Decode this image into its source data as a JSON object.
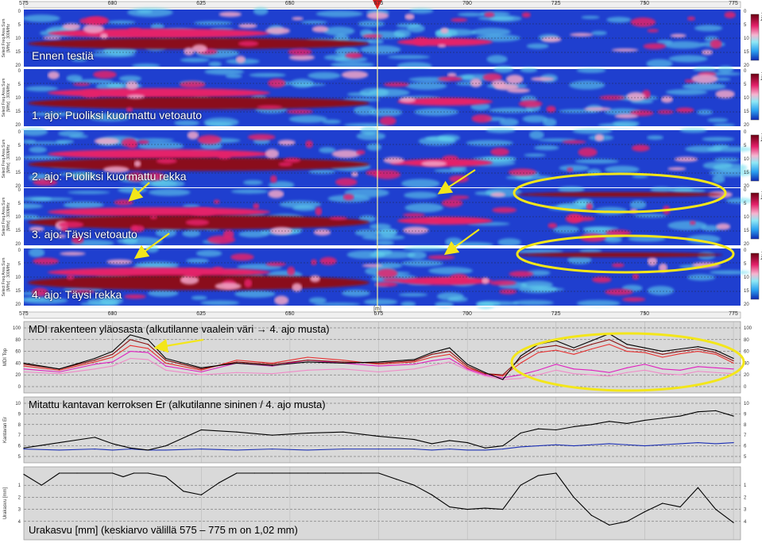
{
  "distance_axis": {
    "ticks": [
      "575",
      "600",
      "625",
      "650",
      "675",
      "700",
      "725",
      "750",
      "775"
    ],
    "unit": "[m]",
    "range": [
      575,
      777
    ],
    "marker_at": 674
  },
  "radar_panels": {
    "ylabel": "Select Freq Area Sum",
    "ylabel2": "[MHz] : 300MHz",
    "colorbar_label": "Freq",
    "depth_ticks": [
      "0",
      "5",
      "10",
      "15",
      "20"
    ],
    "titles": [
      "Ennen testiä",
      "1. ajo: Puoliksi kuormattu vetoauto",
      "2. ajo: Puoliksi kuormattu  rekka",
      "3. ajo: Täysi vetoauto",
      "4. ajo: Täysi rekka"
    ],
    "colors": {
      "background": "#1f3fcf",
      "strong": "#8a0a1a",
      "mid": "#e4206a",
      "weak": "#f2a6c8",
      "light": "#66ddee"
    }
  },
  "annotation_colors": {
    "arrow": "#f3e61a",
    "ellipse": "#f3e61a"
  },
  "chart_data": [
    {
      "type": "line",
      "title": "MDI rakenteen yläosasta (alkutilanne vaalein väri → 4. ajo musta)",
      "ylabel": "MDI Top",
      "ylim": [
        0,
        100
      ],
      "yticks": [
        0,
        20,
        40,
        60,
        80,
        100
      ],
      "x": [
        575,
        585,
        595,
        600,
        605,
        610,
        615,
        625,
        635,
        645,
        655,
        665,
        675,
        685,
        690,
        695,
        700,
        705,
        710,
        715,
        720,
        725,
        730,
        735,
        740,
        745,
        750,
        755,
        760,
        765,
        770,
        775
      ],
      "series": [
        {
          "color": "#f08ac8",
          "values": [
            25,
            22,
            30,
            35,
            48,
            46,
            28,
            20,
            24,
            22,
            28,
            30,
            25,
            30,
            36,
            42,
            28,
            18,
            12,
            14,
            20,
            28,
            22,
            20,
            18,
            24,
            28,
            22,
            20,
            26,
            24,
            22
          ]
        },
        {
          "color": "#e020c0",
          "values": [
            30,
            25,
            38,
            42,
            60,
            58,
            35,
            25,
            40,
            35,
            45,
            40,
            35,
            38,
            44,
            48,
            30,
            20,
            15,
            20,
            28,
            38,
            30,
            28,
            24,
            32,
            38,
            30,
            28,
            34,
            32,
            30
          ]
        },
        {
          "color": "#e83030",
          "values": [
            35,
            28,
            42,
            50,
            70,
            65,
            40,
            28,
            45,
            40,
            50,
            45,
            38,
            42,
            50,
            55,
            32,
            22,
            18,
            40,
            58,
            62,
            55,
            64,
            72,
            60,
            58,
            50,
            56,
            60,
            55,
            40
          ]
        },
        {
          "color": "#8a1010",
          "values": [
            38,
            30,
            45,
            55,
            80,
            72,
            45,
            30,
            42,
            38,
            45,
            42,
            40,
            44,
            55,
            60,
            35,
            22,
            20,
            48,
            66,
            70,
            62,
            72,
            80,
            66,
            62,
            55,
            60,
            64,
            58,
            44
          ]
        },
        {
          "color": "#000000",
          "values": [
            40,
            30,
            48,
            60,
            88,
            80,
            48,
            32,
            40,
            36,
            42,
            40,
            42,
            46,
            58,
            66,
            38,
            24,
            12,
            52,
            72,
            78,
            66,
            78,
            90,
            72,
            66,
            60,
            64,
            68,
            62,
            48
          ]
        }
      ]
    },
    {
      "type": "line",
      "title": "Mitattu kantavan kerroksen Er (alkutilanne sininen / 4. ajo musta)",
      "ylabel": "Kantavan Er",
      "ylim": [
        5,
        10
      ],
      "yticks": [
        5,
        6,
        7,
        8,
        9,
        10
      ],
      "x": [
        575,
        585,
        595,
        600,
        605,
        610,
        615,
        625,
        635,
        645,
        655,
        665,
        675,
        685,
        690,
        695,
        700,
        705,
        710,
        715,
        720,
        725,
        730,
        735,
        740,
        745,
        750,
        755,
        760,
        765,
        770,
        775
      ],
      "series": [
        {
          "color": "#1b2fb5",
          "values": [
            5.7,
            5.6,
            5.7,
            5.6,
            5.7,
            5.6,
            5.6,
            5.7,
            5.6,
            5.7,
            5.6,
            5.7,
            5.7,
            5.7,
            5.6,
            5.7,
            5.6,
            5.6,
            5.7,
            5.9,
            6.0,
            6.1,
            6.0,
            6.1,
            6.2,
            6.1,
            6.0,
            6.1,
            6.2,
            6.3,
            6.2,
            6.3
          ]
        },
        {
          "color": "#000000",
          "values": [
            5.8,
            6.3,
            6.8,
            6.2,
            5.8,
            5.6,
            6.0,
            7.5,
            7.3,
            7.0,
            7.2,
            7.3,
            6.9,
            6.6,
            6.2,
            6.5,
            6.3,
            5.8,
            6.0,
            7.2,
            7.6,
            7.5,
            7.8,
            8.0,
            8.3,
            8.1,
            8.4,
            8.6,
            8.8,
            9.2,
            9.3,
            8.8
          ]
        }
      ]
    },
    {
      "type": "line",
      "title": "Urakasvu [mm] (keskiarvo välillä 575 – 775 m on 1,02 mm)",
      "ylabel": "Urakasvu [mm]",
      "ylim": [
        0,
        5
      ],
      "yticks": [
        1,
        2,
        3,
        4
      ],
      "y_inverted": true,
      "x": [
        575,
        580,
        585,
        590,
        600,
        603,
        606,
        610,
        615,
        620,
        625,
        630,
        635,
        640,
        645,
        650,
        655,
        660,
        665,
        670,
        675,
        680,
        685,
        690,
        695,
        700,
        705,
        710,
        715,
        720,
        725,
        730,
        735,
        740,
        745,
        750,
        755,
        760,
        765,
        770,
        775
      ],
      "series": [
        {
          "color": "#000000",
          "values": [
            0.1,
            1.0,
            0.0,
            0.0,
            0.0,
            0.3,
            0.0,
            0.0,
            0.3,
            1.5,
            1.8,
            0.8,
            0.0,
            0.0,
            0.0,
            0.0,
            0.0,
            0.0,
            0.0,
            0.0,
            0.0,
            0.5,
            1.0,
            1.8,
            2.8,
            3.0,
            2.9,
            3.0,
            1.0,
            0.2,
            0.0,
            2.0,
            3.5,
            4.3,
            4.0,
            3.2,
            2.5,
            2.8,
            1.2,
            3.0,
            4.1
          ]
        }
      ]
    }
  ],
  "line_panel_labels": {
    "right_ticks_top": [
      "0",
      "20",
      "40",
      "60",
      "80",
      "100"
    ]
  }
}
